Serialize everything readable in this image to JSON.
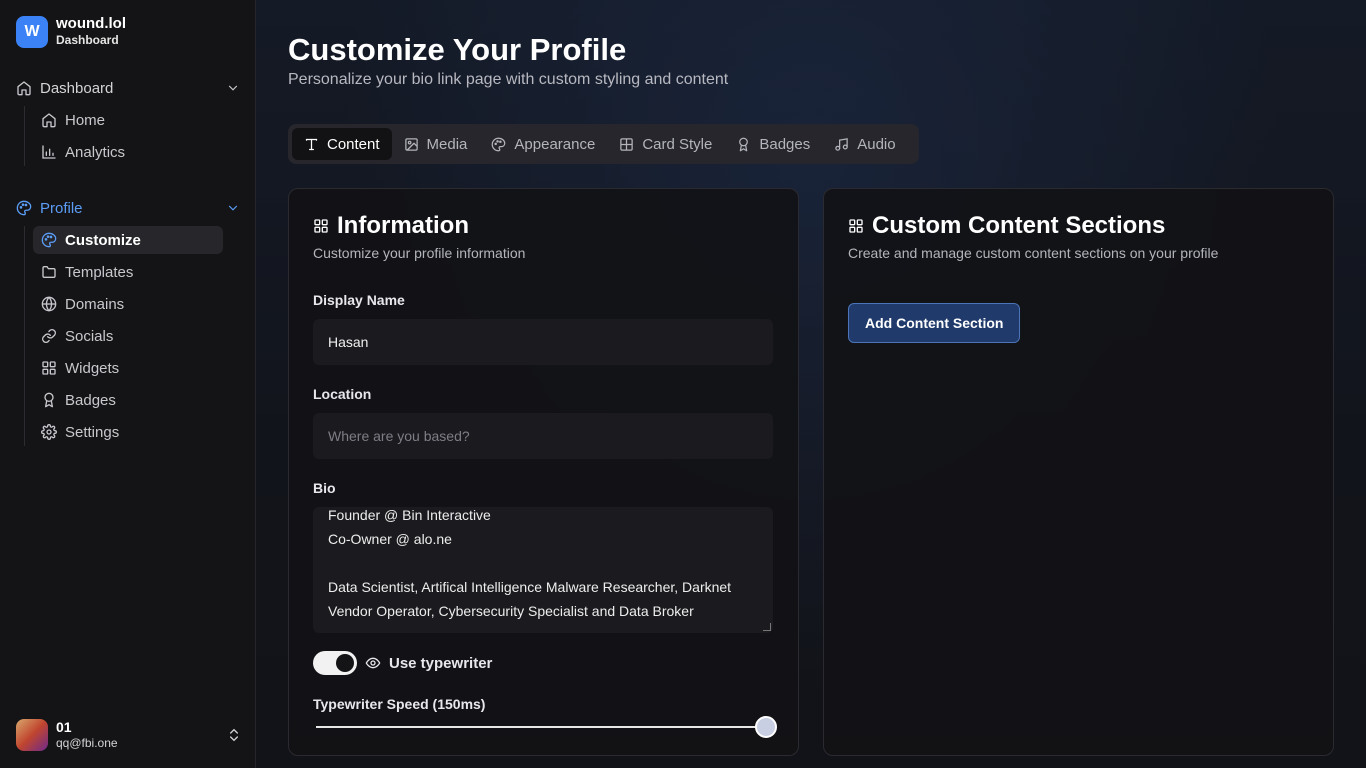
{
  "brand": {
    "logo_letter": "W",
    "title": "wound.lol",
    "subtitle": "Dashboard",
    "color": "#3b82f6"
  },
  "sidebar": {
    "groups": [
      {
        "label": "Dashboard",
        "icon": "home-icon",
        "items": [
          {
            "label": "Home",
            "icon": "home-icon"
          },
          {
            "label": "Analytics",
            "icon": "bar-chart-icon"
          }
        ]
      },
      {
        "label": "Profile",
        "icon": "palette-icon",
        "active": true,
        "items": [
          {
            "label": "Customize",
            "icon": "palette-icon",
            "active": true
          },
          {
            "label": "Templates",
            "icon": "folder-icon"
          },
          {
            "label": "Domains",
            "icon": "globe-icon"
          },
          {
            "label": "Socials",
            "icon": "link-icon"
          },
          {
            "label": "Widgets",
            "icon": "grid-icon"
          },
          {
            "label": "Badges",
            "icon": "award-icon"
          },
          {
            "label": "Settings",
            "icon": "gear-icon"
          }
        ]
      }
    ]
  },
  "user": {
    "name": "01",
    "email": "qq@fbi.one"
  },
  "page": {
    "title": "Customize Your Profile",
    "subtitle": "Personalize your bio link page with custom styling and content"
  },
  "tabs": [
    {
      "label": "Content",
      "icon": "type-icon",
      "active": true
    },
    {
      "label": "Media",
      "icon": "image-icon"
    },
    {
      "label": "Appearance",
      "icon": "palette-icon"
    },
    {
      "label": "Card Style",
      "icon": "layout-icon"
    },
    {
      "label": "Badges",
      "icon": "award-icon"
    },
    {
      "label": "Audio",
      "icon": "music-icon"
    }
  ],
  "information": {
    "title": "Information",
    "description": "Customize your profile information",
    "display_name_label": "Display Name",
    "display_name_value": "Hasan",
    "location_label": "Location",
    "location_placeholder": "Where are you based?",
    "bio_label": "Bio",
    "bio_lines": [
      "Founder @ Bin Interactive",
      "Co-Owner @ alo.ne",
      "",
      "Data Scientist, Artifical Intelligence Malware Researcher, Darknet",
      "Vendor Operator, Cybersecurity Specialist and Data Broker"
    ],
    "typewriter_label": "Use typewriter",
    "typewriter_enabled": true,
    "speed_label": "Typewriter Speed (150ms)",
    "speed_fraction": 1.0
  },
  "custom_sections": {
    "title": "Custom Content Sections",
    "description": "Create and manage custom content sections on your profile",
    "add_button": "Add Content Section"
  },
  "colors": {
    "accent_blue": "#5b9cf5",
    "button_bg": "#1f3a6b",
    "button_border": "#4c74b8"
  }
}
